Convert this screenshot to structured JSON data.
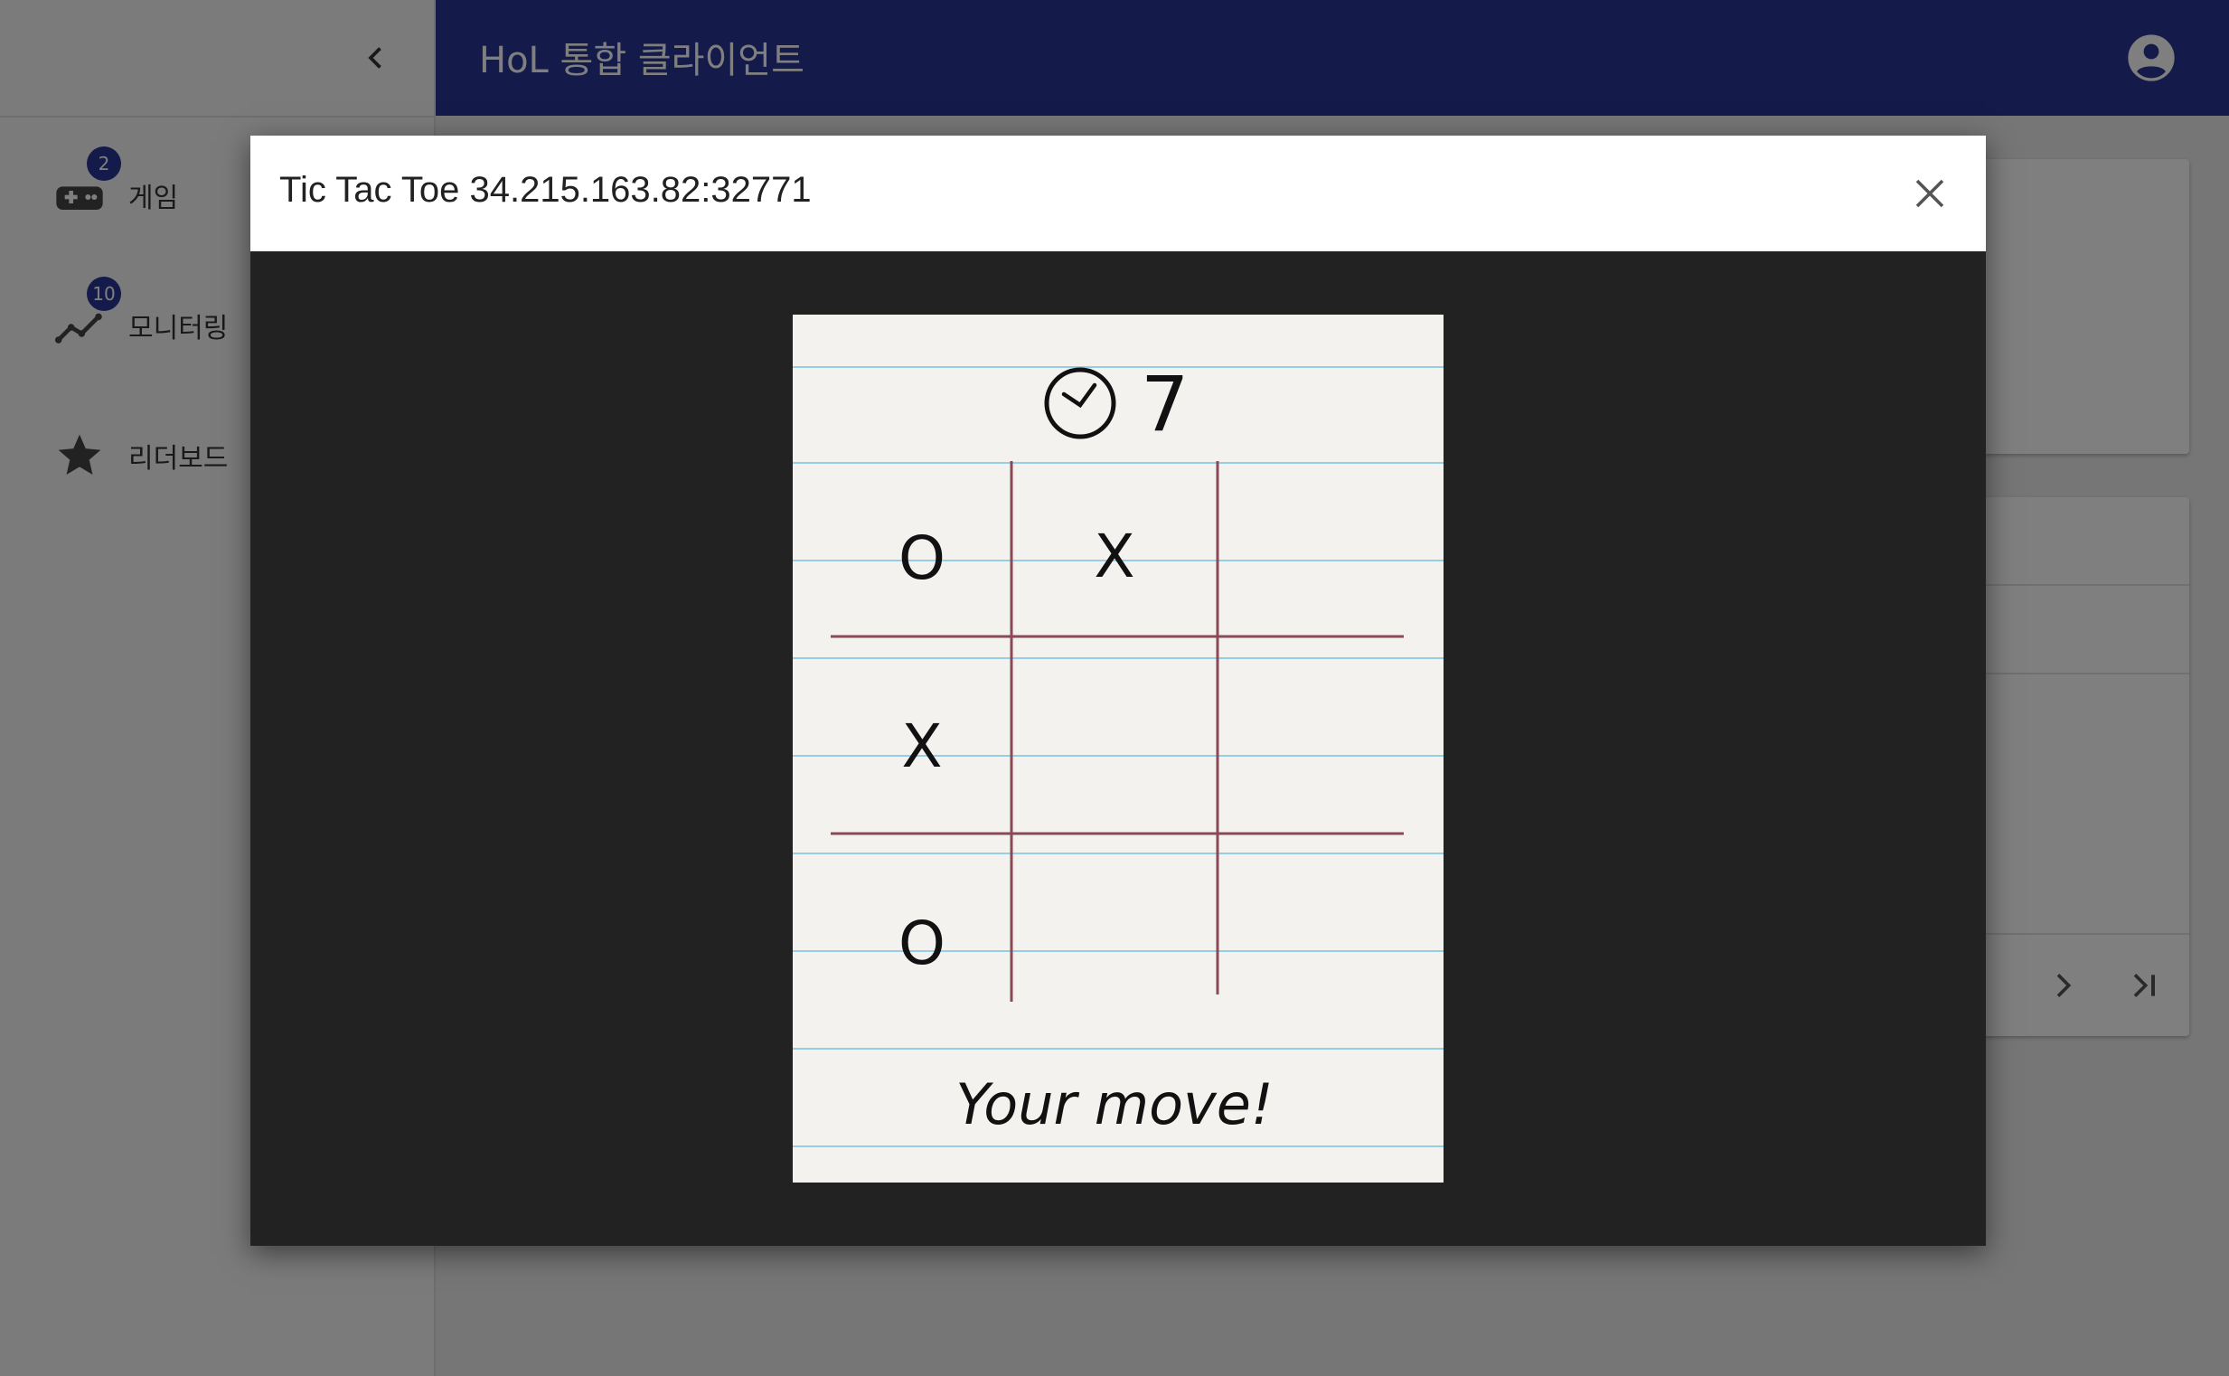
{
  "app": {
    "title": "HoL 통합 클라이언트"
  },
  "sidebar": {
    "items": [
      {
        "label": "게임",
        "badge": "2",
        "icon": "gamepad-icon"
      },
      {
        "label": "모니터링",
        "badge": "10",
        "icon": "timeline-icon"
      },
      {
        "label": "리더보드",
        "icon": "star-icon"
      }
    ]
  },
  "dialog": {
    "title": "Tic Tac Toe 34.215.163.82:32771",
    "game": {
      "timer": "7",
      "board": [
        [
          "O",
          "X",
          ""
        ],
        [
          "X",
          "",
          ""
        ],
        [
          "O",
          "",
          ""
        ]
      ],
      "status": "Your move!"
    }
  },
  "colors": {
    "primary": "#283593",
    "paper": "#f4f2ef",
    "grid": "#8a4a55",
    "ruled": "#8ec9e6"
  }
}
